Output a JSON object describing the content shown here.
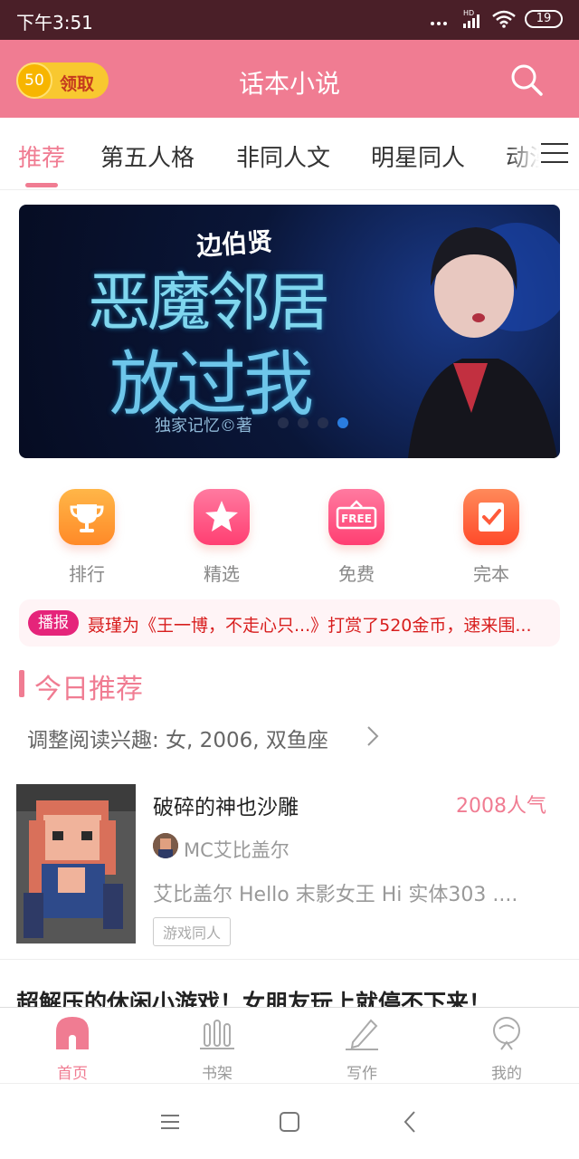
{
  "status_bar": {
    "time": "下午3:51",
    "network": "HD",
    "battery": "19"
  },
  "header": {
    "coin_value": "50",
    "coin_label": "领取",
    "title": "话本小说"
  },
  "tabs": [
    {
      "label": "推荐",
      "active": true
    },
    {
      "label": "第五人格"
    },
    {
      "label": "非同人文"
    },
    {
      "label": "明星同人"
    },
    {
      "label": "动漫"
    }
  ],
  "banner": {
    "author_line": "边伯贤",
    "title_line1": "恶魔邻居",
    "title_line2": "放过我",
    "credit": "独家记忆©著",
    "page_count": 4,
    "active_page": 4
  },
  "quick_links": [
    {
      "label": "排行",
      "icon": "trophy-icon",
      "color": "#ffa33a"
    },
    {
      "label": "精选",
      "icon": "star-icon",
      "color": "#ff5a86"
    },
    {
      "label": "免费",
      "icon": "free-tag-icon",
      "color": "#ff5a86"
    },
    {
      "label": "完本",
      "icon": "checklist-icon",
      "color": "#ff6a3d"
    }
  ],
  "broadcast": {
    "badge": "播报",
    "text": "聂瑾为《王一博，不走心只...》打赏了520金币，速来围..."
  },
  "section": {
    "title": "今日推荐",
    "interest": "调整阅读兴趣: 女, 2006, 双鱼座"
  },
  "book": {
    "title": "破碎的神也沙雕",
    "popularity": "2008人气",
    "author": "MC艾比盖尔",
    "description": "艾比盖尔 Hello 末影女王 Hi 实体303 ....",
    "tag": "游戏同人"
  },
  "next_book_title": "超解压的休闲小游戏！女朋友玩上就停不下来！",
  "bottom_nav": [
    {
      "label": "首页",
      "icon": "home-icon",
      "active": true
    },
    {
      "label": "书架",
      "icon": "bookshelf-icon"
    },
    {
      "label": "写作",
      "icon": "pencil-icon"
    },
    {
      "label": "我的",
      "icon": "profile-icon"
    }
  ],
  "colors": {
    "accent": "#f07c92",
    "status_bar": "#4a1f28",
    "broadcast_text": "#d81e1e",
    "badge": "#e5247a"
  }
}
